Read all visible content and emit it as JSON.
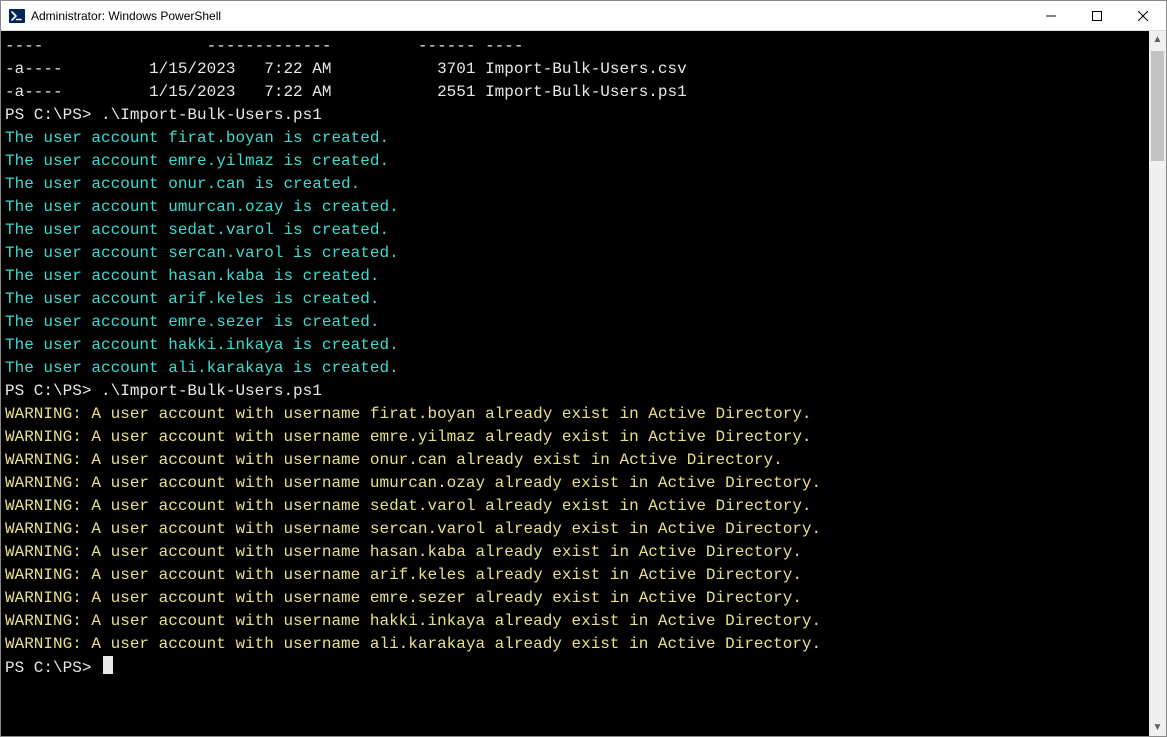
{
  "window": {
    "title": "Administrator: Windows PowerShell"
  },
  "listing": {
    "header": "----                 -------------         ------ ----",
    "rows": [
      "-a----         1/15/2023   7:22 AM           3701 Import-Bulk-Users.csv",
      "-a----         1/15/2023   7:22 AM           2551 Import-Bulk-Users.ps1"
    ]
  },
  "prompts": {
    "p1_prompt": "PS C:\\PS> ",
    "p1_cmd": ".\\Import-Bulk-Users.ps1",
    "p2_prompt": "PS C:\\PS> ",
    "p2_cmd": ".\\Import-Bulk-Users.ps1",
    "p3_prompt": "PS C:\\PS> "
  },
  "created": [
    "The user account firat.boyan is created.",
    "The user account emre.yilmaz is created.",
    "The user account onur.can is created.",
    "The user account umurcan.ozay is created.",
    "The user account sedat.varol is created.",
    "The user account sercan.varol is created.",
    "The user account hasan.kaba is created.",
    "The user account arif.keles is created.",
    "The user account emre.sezer is created.",
    "The user account hakki.inkaya is created.",
    "The user account ali.karakaya is created."
  ],
  "warnings": [
    "WARNING: A user account with username firat.boyan already exist in Active Directory.",
    "WARNING: A user account with username emre.yilmaz already exist in Active Directory.",
    "WARNING: A user account with username onur.can already exist in Active Directory.",
    "WARNING: A user account with username umurcan.ozay already exist in Active Directory.",
    "WARNING: A user account with username sedat.varol already exist in Active Directory.",
    "WARNING: A user account with username sercan.varol already exist in Active Directory.",
    "WARNING: A user account with username hasan.kaba already exist in Active Directory.",
    "WARNING: A user account with username arif.keles already exist in Active Directory.",
    "WARNING: A user account with username emre.sezer already exist in Active Directory.",
    "WARNING: A user account with username hakki.inkaya already exist in Active Directory.",
    "WARNING: A user account with username ali.karakaya already exist in Active Directory."
  ]
}
